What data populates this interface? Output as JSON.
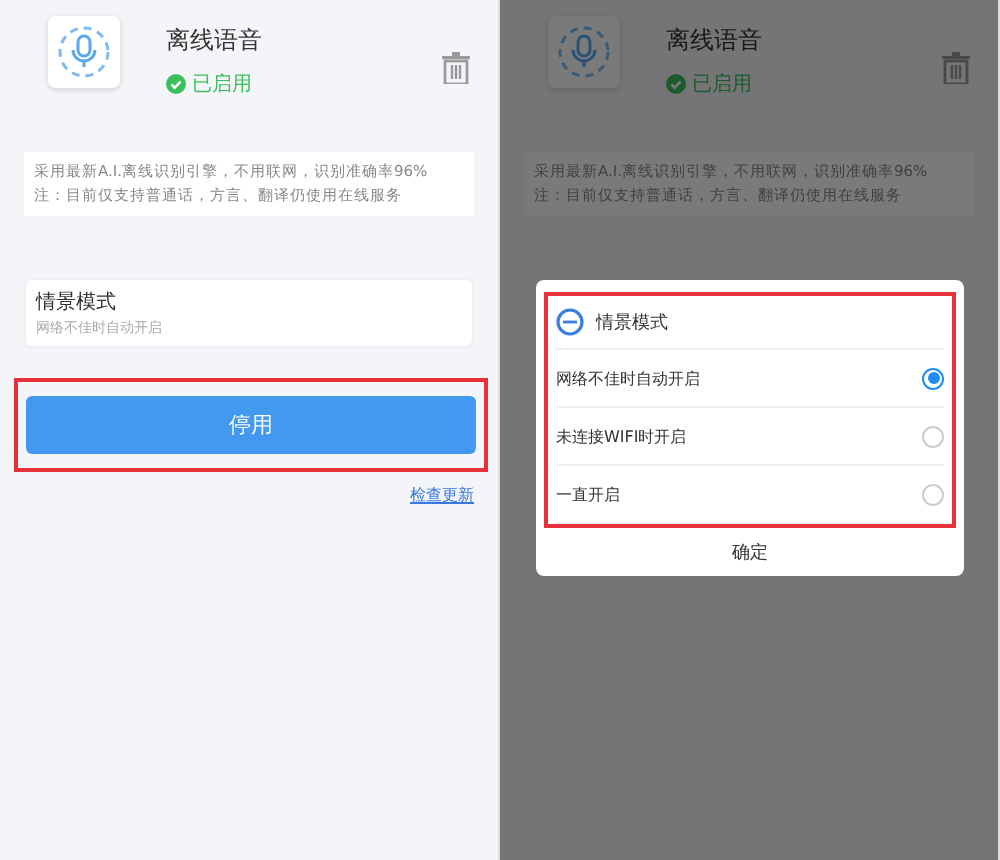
{
  "screens": [
    {
      "app": {
        "title": "离线语音",
        "status": "已启用"
      },
      "description": [
        "采用最新A.I.离线识别引擎，不用联网，识别准确率96%",
        "注：目前仅支持普通话，方言、翻译仍使用在线服务"
      ],
      "scene": {
        "title": "情景模式",
        "subtitle": "网络不佳时自动开启"
      },
      "button": {
        "label": "停用",
        "highlighted": true
      },
      "link": "检查更新"
    },
    {
      "app": {
        "title": "离线语音",
        "status": "已启用"
      },
      "description": [
        "采用最新A.I.离线识别引擎，不用联网，识别准确率96%",
        "注：目前仅支持普通话，方言、翻译仍使用在线服务"
      ],
      "dialog": {
        "title": "情景模式",
        "highlighted": true,
        "options": [
          {
            "label": "网络不佳时自动开启",
            "selected": true
          },
          {
            "label": "未连接WIFI时开启",
            "selected": false
          },
          {
            "label": "一直开启",
            "selected": false
          }
        ],
        "confirm": "确定"
      }
    }
  ]
}
